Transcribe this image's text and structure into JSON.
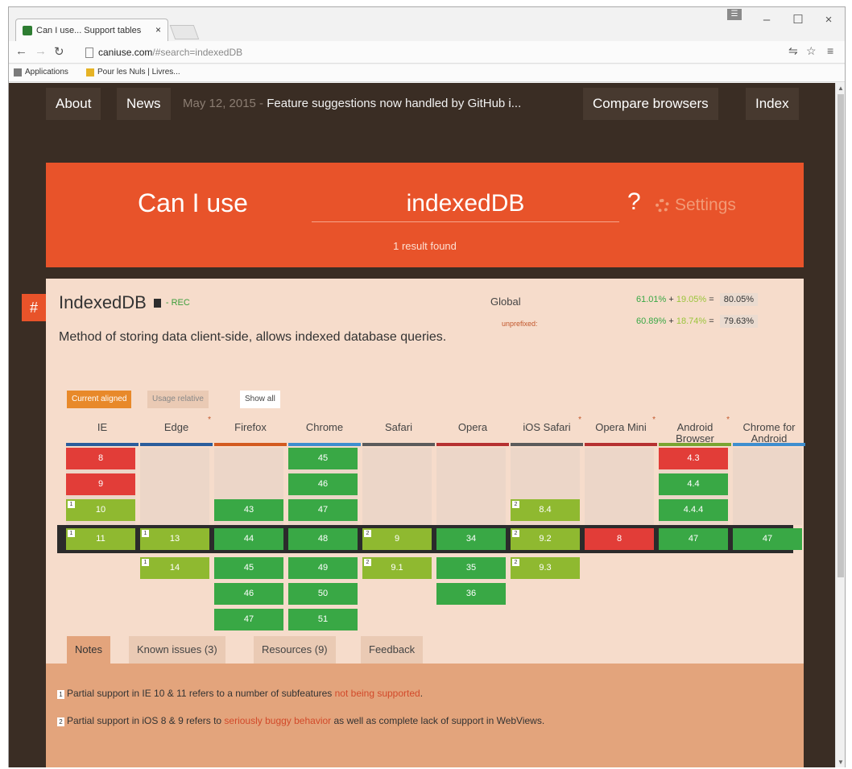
{
  "browser": {
    "tab_title": "Can I use... Support tables",
    "tab_close": "×",
    "url_host": "caniuse.com",
    "url_path": "/#search=indexedDB",
    "window_controls": [
      "–",
      "☐",
      "×"
    ],
    "bookmarks": [
      "Applications",
      "Pour les Nuls | Livres..."
    ]
  },
  "nav": {
    "about": "About",
    "news": "News",
    "news_date": "May 12, 2015 -",
    "news_text": "Feature suggestions now handled by GitHub i...",
    "compare": "Compare browsers",
    "index": "Index"
  },
  "search": {
    "prefix": "Can I use",
    "query": "indexedDB",
    "question": "?",
    "settings": "Settings",
    "results": "1 result found"
  },
  "feature": {
    "hash": "#",
    "title": "IndexedDB",
    "status": "- REC",
    "description": "Method of storing data client-side, allows indexed database queries.",
    "global_label": "Global",
    "global_full": "61.01%",
    "global_partial": "19.05%",
    "global_total": "80.05%",
    "unprefixed_label": "unprefixed:",
    "unprefixed_full": "60.89%",
    "unprefixed_partial": "18.74%",
    "unprefixed_total": "79.63%",
    "plus": "+",
    "equals": "=",
    "controls": {
      "current_aligned": "Current aligned",
      "usage_relative": "Usage relative",
      "show_all": "Show all"
    }
  },
  "browsers": [
    {
      "name": "IE",
      "color": "#2b5d9c",
      "star": false,
      "cells": [
        {
          "v": "8",
          "s": "n"
        },
        {
          "v": "9",
          "s": "n"
        },
        {
          "v": "10",
          "s": "a",
          "note": "1"
        },
        {
          "v": "11",
          "s": "a",
          "note": "1",
          "cur": true
        }
      ]
    },
    {
      "name": "Edge",
      "color": "#2b5d9c",
      "star": true,
      "cells": [
        {
          "v": "13",
          "s": "a",
          "note": "1",
          "cur": true
        },
        {
          "v": "14",
          "s": "a",
          "note": "1"
        }
      ]
    },
    {
      "name": "Firefox",
      "color": "#d35a1f",
      "star": false,
      "cells": [
        {
          "v": "43",
          "s": "y"
        },
        {
          "v": "44",
          "s": "y",
          "cur": true
        },
        {
          "v": "45",
          "s": "y"
        },
        {
          "v": "46",
          "s": "y"
        },
        {
          "v": "47",
          "s": "y"
        }
      ]
    },
    {
      "name": "Chrome",
      "color": "#3e8ecf",
      "star": false,
      "cells": [
        {
          "v": "45",
          "s": "y"
        },
        {
          "v": "46",
          "s": "y"
        },
        {
          "v": "47",
          "s": "y"
        },
        {
          "v": "48",
          "s": "y",
          "cur": true
        },
        {
          "v": "49",
          "s": "y"
        },
        {
          "v": "50",
          "s": "y"
        },
        {
          "v": "51",
          "s": "y"
        }
      ]
    },
    {
      "name": "Safari",
      "color": "#5b5b5b",
      "star": false,
      "cells": [
        {
          "v": "9",
          "s": "a",
          "note": "2",
          "cur": true
        },
        {
          "v": "9.1",
          "s": "a",
          "note": "2"
        }
      ]
    },
    {
      "name": "Opera",
      "color": "#b63131",
      "star": false,
      "cells": [
        {
          "v": "34",
          "s": "y",
          "cur": true
        },
        {
          "v": "35",
          "s": "y"
        },
        {
          "v": "36",
          "s": "y"
        }
      ]
    },
    {
      "name": "iOS Safari",
      "color": "#5b5b5b",
      "star": true,
      "cells": [
        {
          "v": "8.4",
          "s": "a",
          "note": "2"
        },
        {
          "v": "9.2",
          "s": "a",
          "note": "2",
          "cur": true
        },
        {
          "v": "9.3",
          "s": "a",
          "note": "2"
        }
      ]
    },
    {
      "name": "Opera Mini",
      "color": "#b63131",
      "star": true,
      "cells": [
        {
          "v": "8",
          "s": "n",
          "cur": true
        }
      ]
    },
    {
      "name": "Android Browser",
      "color": "#7aa531",
      "star": true,
      "cells": [
        {
          "v": "4.3",
          "s": "n"
        },
        {
          "v": "4.4",
          "s": "y"
        },
        {
          "v": "4.4.4",
          "s": "y"
        },
        {
          "v": "47",
          "s": "y",
          "cur": true
        }
      ]
    },
    {
      "name": "Chrome for Android",
      "color": "#3e8ecf",
      "star": false,
      "cells": [
        {
          "v": "47",
          "s": "y",
          "cur": true
        }
      ]
    }
  ],
  "support_colors": {
    "y": "#39a845",
    "a": "#8fb930",
    "n": "#e23d38"
  },
  "tabs": [
    "Notes",
    "Known issues (3)",
    "Resources (9)",
    "Feedback"
  ],
  "notes": [
    {
      "num": "1",
      "before": "Partial support in IE 10 & 11 refers to a number of subfeatures ",
      "link": "not being supported",
      "after": "."
    },
    {
      "num": "2",
      "before": "Partial support in iOS 8 & 9 refers to ",
      "link": "seriously buggy behavior",
      "after": " as well as complete lack of support in WebViews."
    }
  ]
}
